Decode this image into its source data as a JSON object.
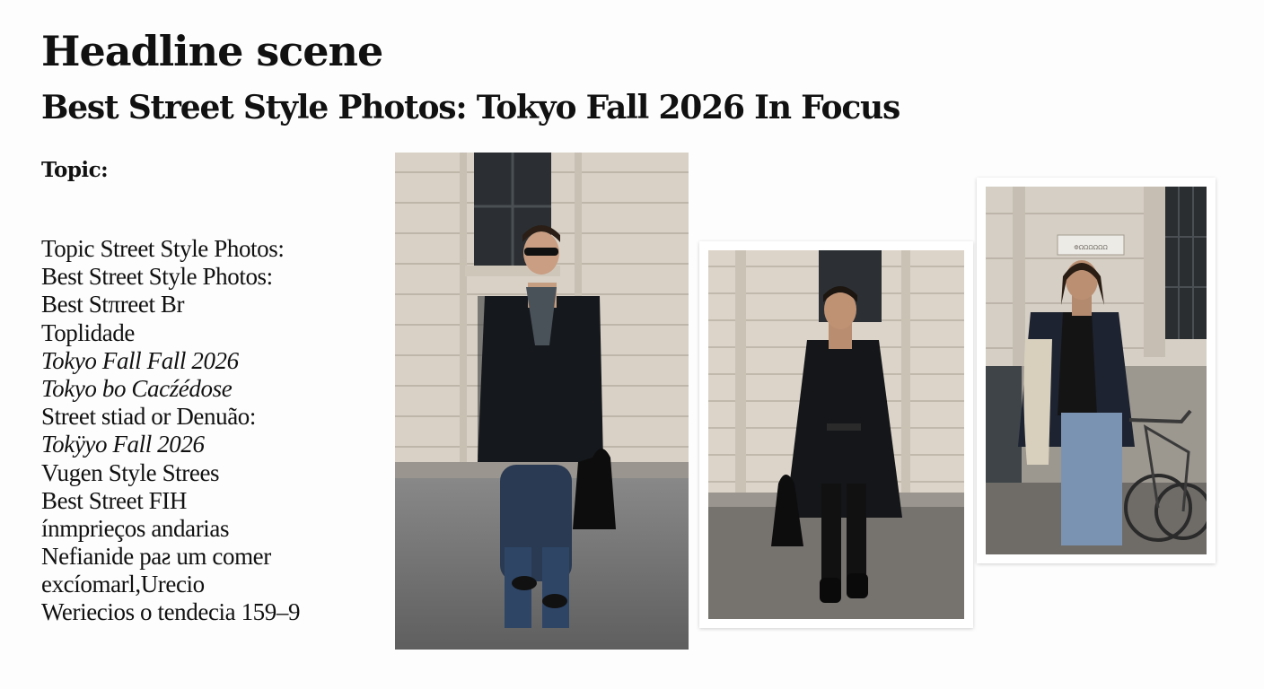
{
  "header": {
    "title": "Headline scene",
    "subtitle": "Best Street Style Photos: Tokyo Fall 2026 In Focus"
  },
  "topic": {
    "label": "Topic:"
  },
  "body_lines": [
    {
      "text": "Topic Street Style Photos:",
      "italic": false
    },
    {
      "text": "Best Street Style Photos:",
      "italic": false
    },
    {
      "text": "Best Stπreet Br",
      "italic": false
    },
    {
      "text": "Toplidade",
      "italic": false
    },
    {
      "text": "Tokyo Fall Fall 2026",
      "italic": true
    },
    {
      "text": "Tokyo bo Cacźédose",
      "italic": true
    },
    {
      "text": "Street stiad or Denuão:",
      "italic": false
    },
    {
      "text": "Tokÿyo Fall 2026",
      "italic": true
    },
    {
      "text": "Vugen Style Strees",
      "italic": false
    },
    {
      "text": "Best Street  FIΗ",
      "italic": false
    },
    {
      "text": "ínmprieços andarias",
      "italic": false
    },
    {
      "text": "Nefianide  paƨ um comer",
      "italic": false
    },
    {
      "text": "excíomarl,Urecio",
      "italic": false
    },
    {
      "text": "Weriecios o tendecia 159–9",
      "italic": false
    }
  ],
  "photos": [
    {
      "name": "man-sunglasses-peacoat-photo",
      "sign_text": ""
    },
    {
      "name": "man-long-black-coat-photo",
      "sign_text": ""
    },
    {
      "name": "man-bicycle-jacket-photo",
      "sign_text": "ΦΩΩΩΩΩΩ"
    }
  ]
}
